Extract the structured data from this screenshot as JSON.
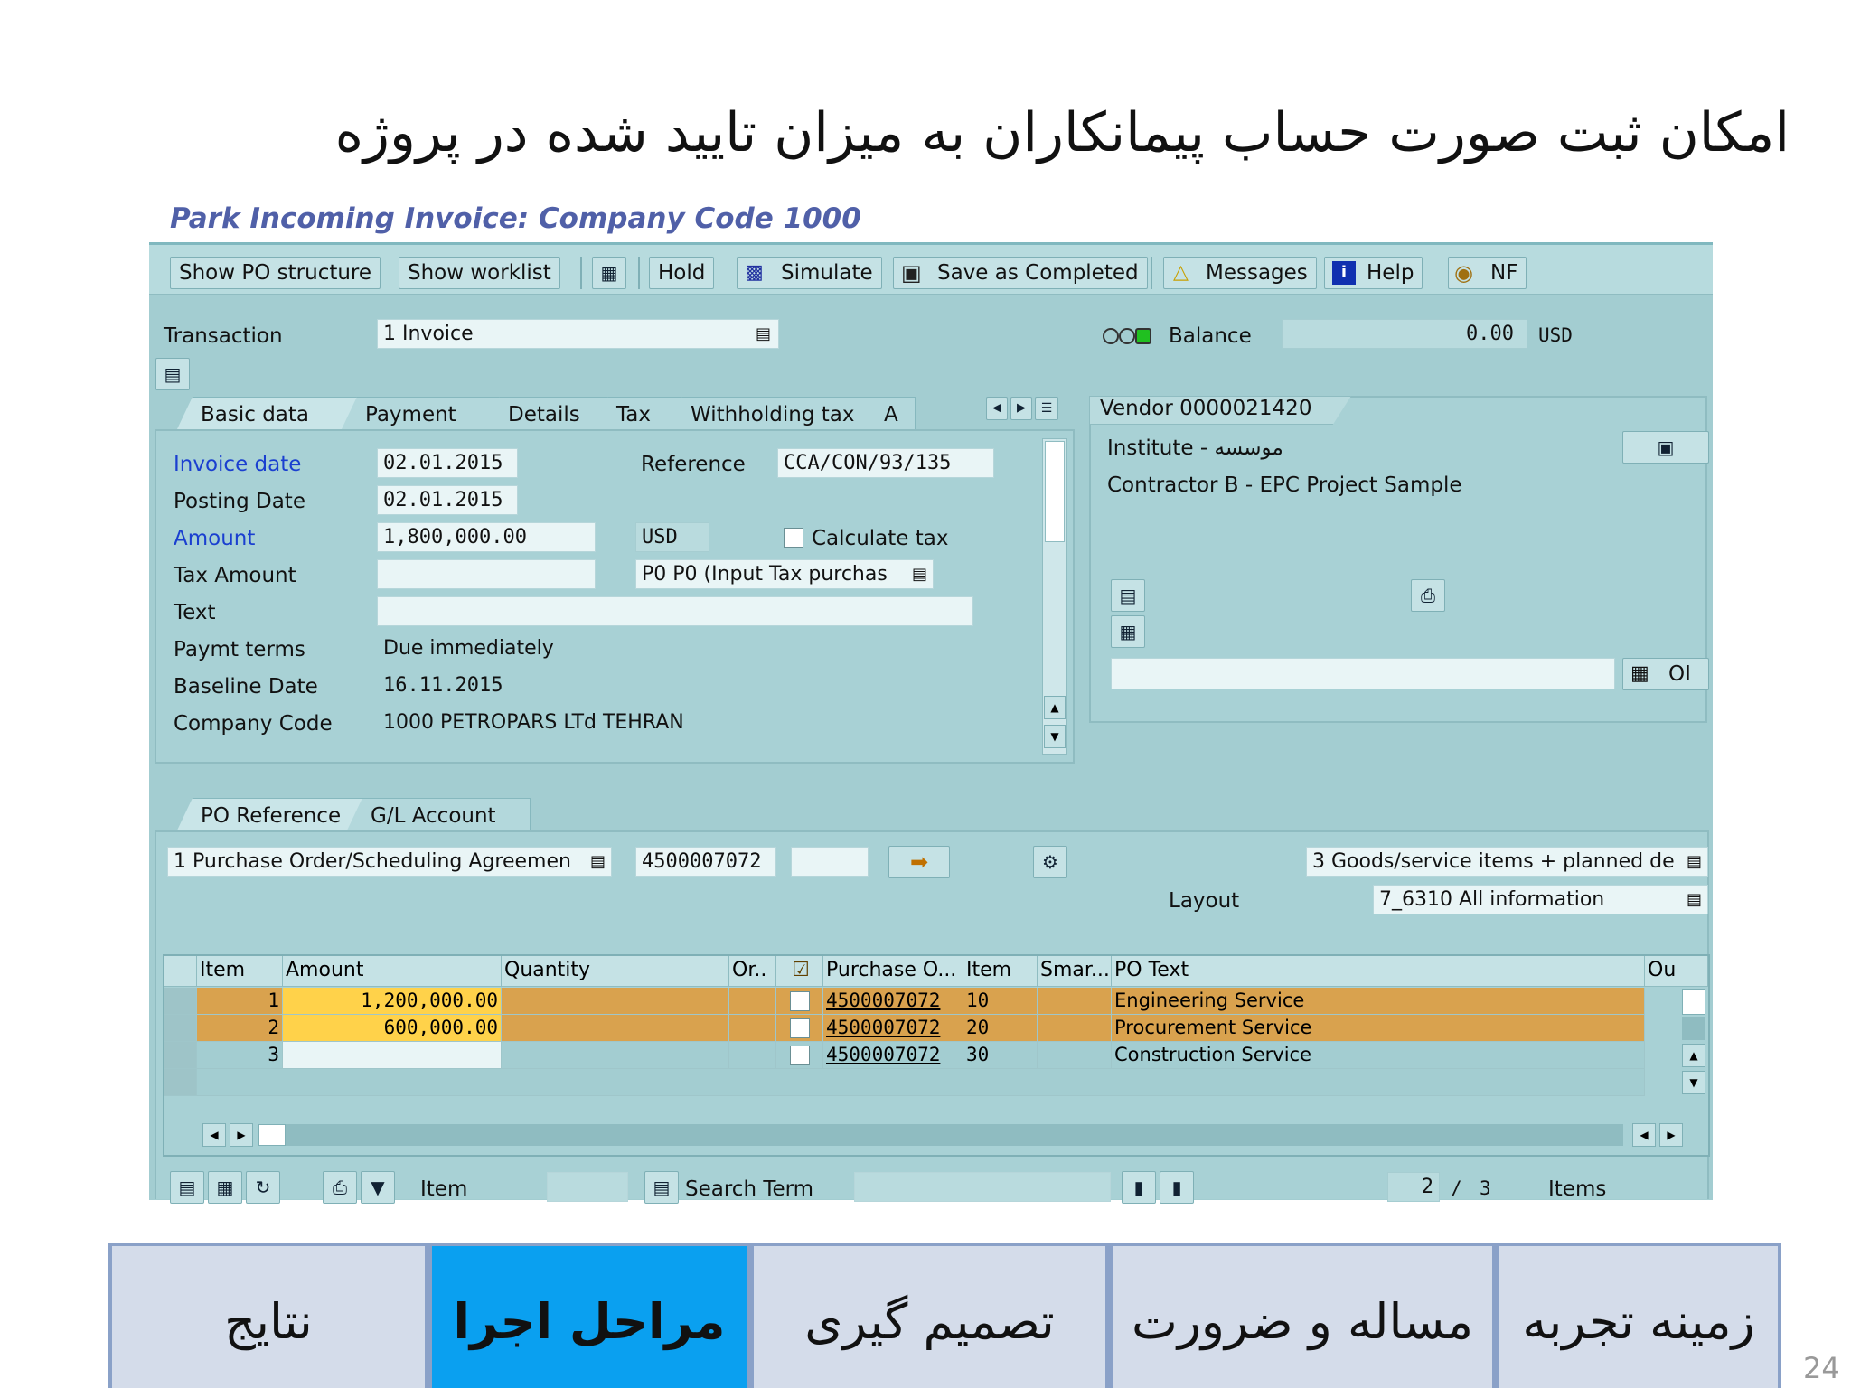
{
  "slide": {
    "title": "امکان ثبت صورت حساب پیمانکاران به میزان تایید شده در پروژه",
    "page_number": "24"
  },
  "sap_title": "Park Incoming Invoice: Company Code 1000",
  "toolbar": {
    "show_po_structure": "Show PO structure",
    "show_worklist": "Show worklist",
    "hold": "Hold",
    "simulate": "Simulate",
    "save_completed": "Save as Completed",
    "messages": "Messages",
    "help": "Help",
    "nf": "NF"
  },
  "header": {
    "transaction_label": "Transaction",
    "transaction_value": "1 Invoice",
    "balance_label": "Balance",
    "balance_value": "0.00",
    "balance_currency": "USD"
  },
  "tabs": [
    "Basic data",
    "Payment",
    "Details",
    "Tax",
    "Withholding tax",
    "A"
  ],
  "basic": {
    "invoice_date_label": "Invoice date",
    "invoice_date": "02.01.2015",
    "reference_label": "Reference",
    "reference": "CCA/CON/93/135",
    "posting_date_label": "Posting Date",
    "posting_date": "02.01.2015",
    "amount_label": "Amount",
    "amount": "1,800,000.00",
    "currency": "USD",
    "calc_tax_label": "Calculate tax",
    "tax_amount_label": "Tax Amount",
    "tax_code": "P0 P0 (Input Tax purchas",
    "text_label": "Text",
    "paymt_terms_label": "Paymt terms",
    "paymt_terms": "Due immediately",
    "baseline_label": "Baseline Date",
    "baseline_date": "16.11.2015",
    "company_code_label": "Company Code",
    "company_code": "1000 PETROPARS LTd TEHRAN"
  },
  "vendor": {
    "title": "Vendor 0000021420",
    "line1": "Institute - موسسه",
    "line2": "Contractor B - EPC Project Sample",
    "oi_label": "OI"
  },
  "po_tabs": [
    "PO Reference",
    "G/L Account"
  ],
  "po": {
    "doc_type": "1 Purchase Order/Scheduling Agreemen",
    "po_number": "4500007072",
    "selection": "3 Goods/service items + planned de",
    "layout_label": "Layout",
    "layout_value": "7_6310 All information"
  },
  "grid": {
    "headers": [
      "Item",
      "Amount",
      "Quantity",
      "Or..",
      "Purchase O...",
      "Item",
      "Smar...",
      "PO Text",
      "Ou"
    ],
    "rows": [
      {
        "item": "1",
        "amount": "1,200,000.00",
        "po": "4500007072",
        "po_item": "10",
        "text": "Engineering Service"
      },
      {
        "item": "2",
        "amount": "600,000.00",
        "po": "4500007072",
        "po_item": "20",
        "text": "Procurement  Service"
      },
      {
        "item": "3",
        "amount": "",
        "po": "4500007072",
        "po_item": "30",
        "text": "Construction Service"
      }
    ]
  },
  "footer": {
    "item_label": "Item",
    "search_term_label": "Search Term",
    "count_current": "2",
    "count_sep": "/",
    "count_total": "3",
    "items_label": "Items"
  },
  "nav": [
    "زمینه تجربه",
    "مساله و ضرورت",
    "تصمیم گیری",
    "مراحل اجرا",
    "نتایج"
  ]
}
